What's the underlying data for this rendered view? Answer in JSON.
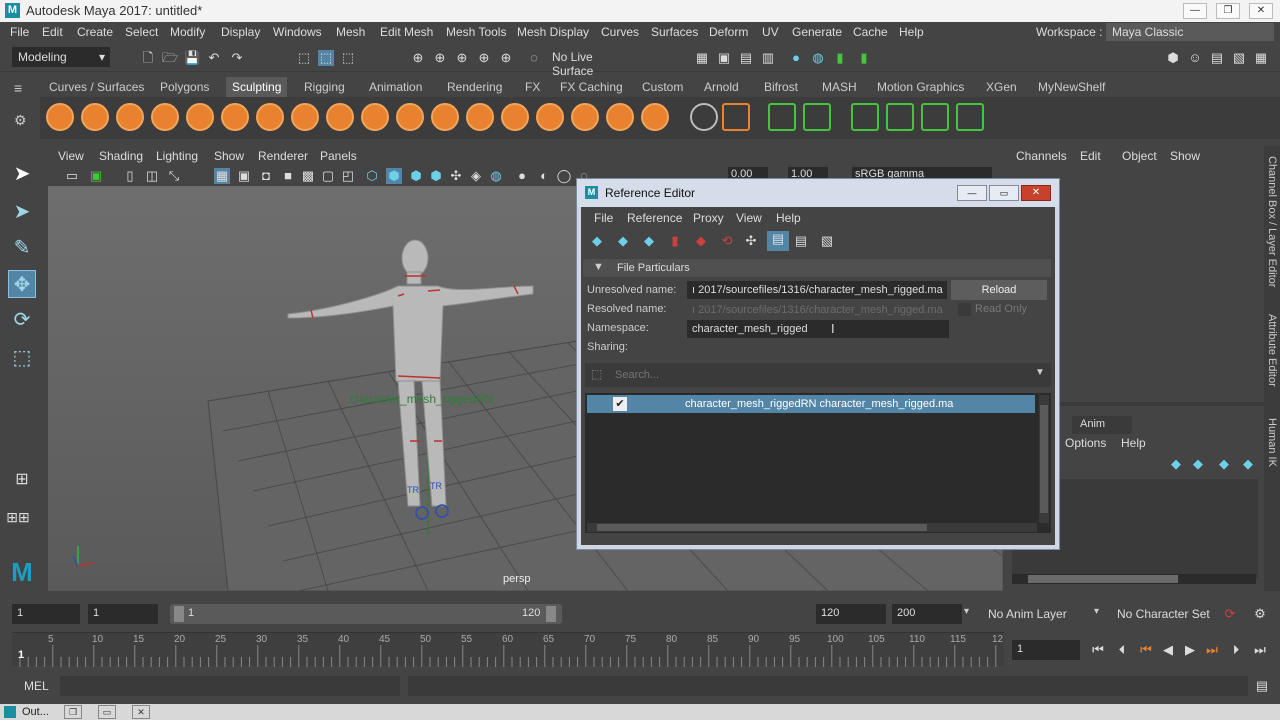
{
  "window": {
    "title": "Autodesk Maya 2017: untitled*"
  },
  "menubar": [
    "File",
    "Edit",
    "Create",
    "Select",
    "Modify",
    "Display",
    "Windows",
    "Mesh",
    "Edit Mesh",
    "Mesh Tools",
    "Mesh Display",
    "Curves",
    "Surfaces",
    "Deform",
    "UV",
    "Generate",
    "Cache",
    "Help"
  ],
  "workspace": {
    "label": "Workspace :",
    "value": "Maya Classic"
  },
  "status": {
    "mode": "Modeling",
    "live_surface": "No Live Surface"
  },
  "shelf_tabs": [
    "Curves / Surfaces",
    "Polygons",
    "Sculpting",
    "Rigging",
    "Animation",
    "Rendering",
    "FX",
    "FX Caching",
    "Custom",
    "Arnold",
    "Bifrost",
    "MASH",
    "Motion Graphics",
    "XGen",
    "MyNewShelf"
  ],
  "shelf_active": "Sculpting",
  "viewport": {
    "menu": [
      "View",
      "Shading",
      "Lighting",
      "Show",
      "Renderer",
      "Panels"
    ],
    "exposure": "0.00",
    "gamma": "1.00",
    "colorspace": "sRGB gamma",
    "camera": "persp",
    "rig_label": "character_mesh_riggedRN",
    "tr_label": "TR"
  },
  "channel_box": {
    "menu": [
      "Channels",
      "Edit",
      "Object",
      "Show"
    ],
    "anim_tab": "Anim",
    "lower_menu": [
      "Options",
      "Help"
    ],
    "side_tabs": [
      "Channel Box / Layer Editor",
      "Attribute Editor",
      "Human IK"
    ]
  },
  "reference_editor": {
    "title": "Reference Editor",
    "menu": [
      "File",
      "Reference",
      "Proxy",
      "View",
      "Help"
    ],
    "section": "File Particulars",
    "unresolved_label": "Unresolved name:",
    "unresolved_value": "ı 2017/sourcefiles/1316/character_mesh_rigged.ma",
    "resolved_label": "Resolved name:",
    "resolved_value": "ı 2017/sourcefiles/1316/character_mesh_rigged.ma",
    "namespace_label": "Namespace:",
    "namespace_value": "character_mesh_rigged",
    "sharing_label": "Sharing:",
    "reload": "Reload",
    "read_only": "Read Only",
    "search_placeholder": "Search...",
    "row": "character_mesh_riggedRN character_mesh_rigged.ma"
  },
  "range": {
    "start": "1",
    "current_start": "1",
    "slider_start": "1",
    "slider_end": "120",
    "end": "120",
    "anim_end": "200",
    "anim_layer": "No Anim Layer",
    "char_set": "No Character Set"
  },
  "timeline": {
    "ticks": [
      "5",
      "10",
      "15",
      "20",
      "25",
      "30",
      "35",
      "40",
      "45",
      "50",
      "55",
      "60",
      "65",
      "70",
      "75",
      "80",
      "85",
      "90",
      "95",
      "100",
      "105",
      "110",
      "115",
      "12"
    ],
    "first": "1",
    "current": "1"
  },
  "cmdline": {
    "label": "MEL"
  },
  "taskbar": {
    "item": "Out..."
  }
}
